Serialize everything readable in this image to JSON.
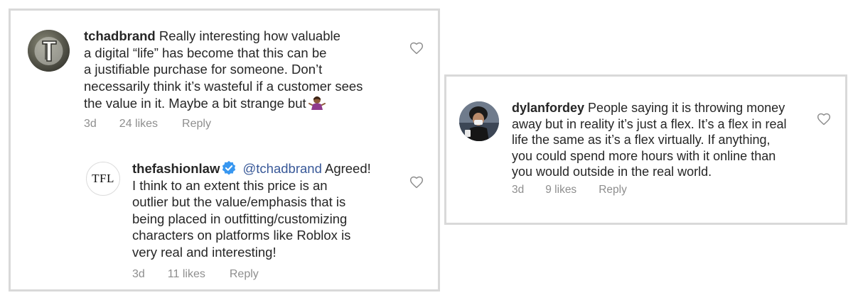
{
  "comments": [
    {
      "username": "tchadbrand",
      "text_lines": [
        "Really interesting how valuable",
        "a digital “life” has become that this can be",
        "a justifiable purchase for someone. Don’t",
        "necessarily think it’s wasteful if a customer sees",
        "the value in it. Maybe a bit strange but"
      ],
      "time": "3d",
      "likes": "24 likes",
      "reply": "Reply",
      "avatar_icon": "rock-logo-avatar",
      "emoji": "person-shrugging-emoji"
    },
    {
      "username": "thefashionlaw",
      "avatar_text": "TFL",
      "mention": "@tchadbrand",
      "text_lines": [
        "Agreed!",
        "I think to an extent this price is an",
        "outlier but the value/emphasis that is",
        "being placed in outfitting/customizing",
        "characters on platforms like Roblox is",
        "very real and interesting!"
      ],
      "time": "3d",
      "likes": "11 likes",
      "reply": "Reply",
      "verified_icon": "verified-badge-icon"
    },
    {
      "username": "dylanfordey",
      "text_lines": [
        "People saying it is throwing money",
        "away but in reality it’s just a flex. It’s a flex in real",
        "life the same as it’s a flex virtually. If anything,",
        "you could spend more hours with it online than",
        "you would outside in the real world."
      ],
      "time": "3d",
      "likes": "9 likes",
      "reply": "Reply",
      "avatar_icon": "person-photo-avatar"
    }
  ],
  "colors": {
    "text": "#262626",
    "meta": "#8e8e8e",
    "mention": "#385898",
    "verified": "#3897f0",
    "border": "#d9d9d9"
  }
}
